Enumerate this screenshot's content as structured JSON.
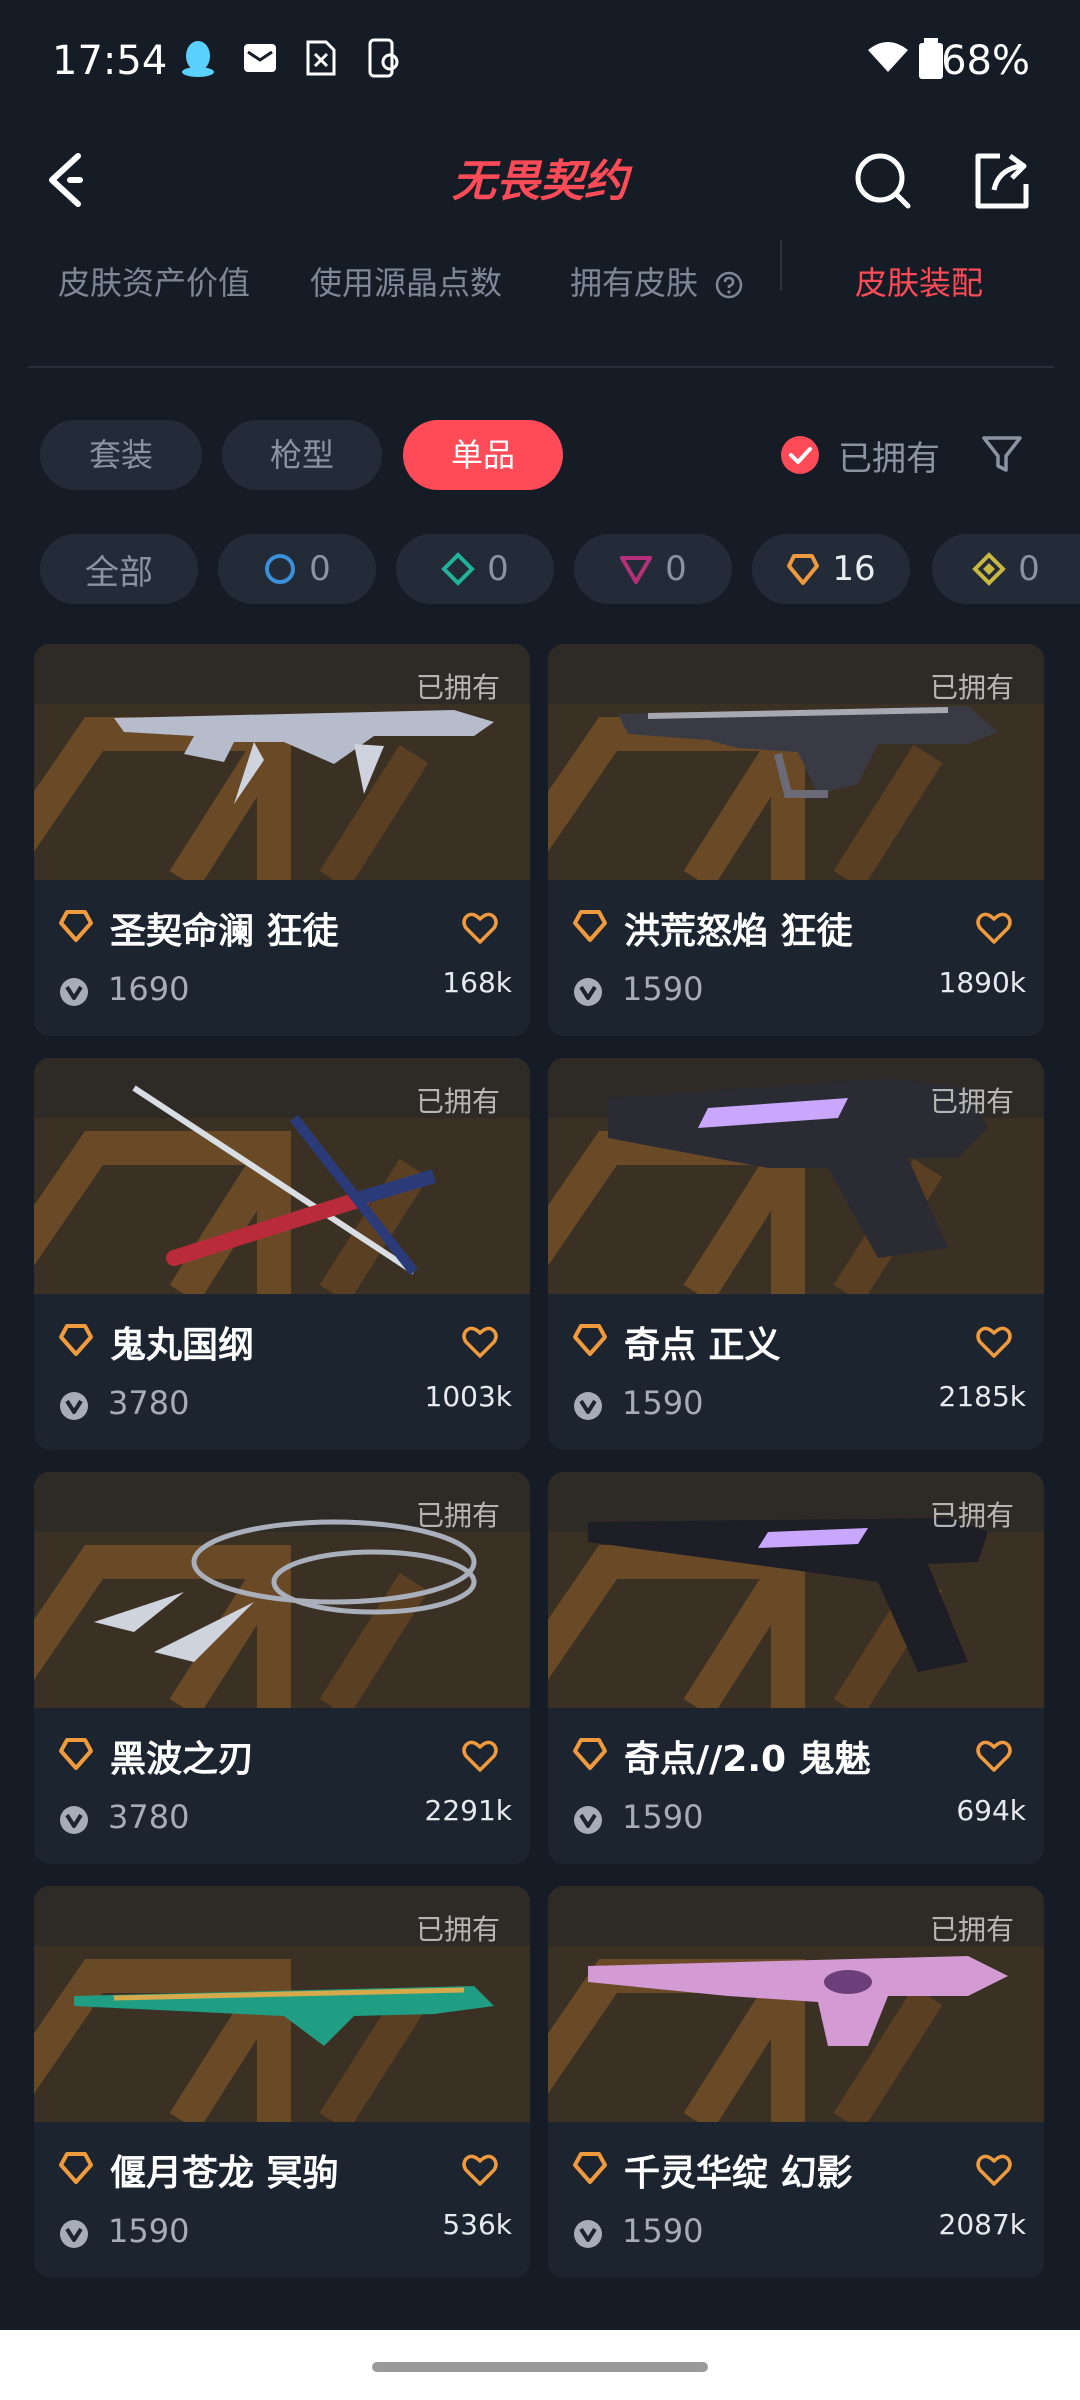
{
  "status_bar": {
    "time": "17:54",
    "battery": "68%"
  },
  "header": {
    "logo_text": "无畏契约"
  },
  "top_tabs": [
    {
      "label": "皮肤资产价值"
    },
    {
      "label": "使用源晶点数"
    },
    {
      "label": "拥有皮肤"
    },
    {
      "label": "皮肤装配"
    }
  ],
  "category_chips": [
    {
      "label": "套装"
    },
    {
      "label": "枪型"
    },
    {
      "label": "单品"
    }
  ],
  "owned_filter_label": "已拥有",
  "rarity_chips": [
    {
      "label": "全部"
    },
    {
      "count": "0",
      "color": "#3a8fd8"
    },
    {
      "count": "0",
      "color": "#1fb39a"
    },
    {
      "count": "0",
      "color": "#b5307a"
    },
    {
      "count": "16",
      "color": "#f09a3e"
    },
    {
      "count": "0",
      "color": "#c8b740"
    }
  ],
  "cards": [
    {
      "owned": "已拥有",
      "name": "圣契命澜 狂徒",
      "price": "1690",
      "likes": "168k"
    },
    {
      "owned": "已拥有",
      "name": "洪荒怒焰 狂徒",
      "price": "1590",
      "likes": "1890k"
    },
    {
      "owned": "已拥有",
      "name": "鬼丸国纲",
      "price": "3780",
      "likes": "1003k"
    },
    {
      "owned": "已拥有",
      "name": "奇点 正义",
      "price": "1590",
      "likes": "2185k"
    },
    {
      "owned": "已拥有",
      "name": "黑波之刃",
      "price": "3780",
      "likes": "2291k"
    },
    {
      "owned": "已拥有",
      "name": "奇点//2.0 鬼魅",
      "price": "1590",
      "likes": "694k"
    },
    {
      "owned": "已拥有",
      "name": "偃月苍龙 冥驹",
      "price": "1590",
      "likes": "536k"
    },
    {
      "owned": "已拥有",
      "name": "千灵华绽 幻影",
      "price": "1590",
      "likes": "2087k"
    }
  ],
  "colors": {
    "accent": "#ff4b57",
    "background": "#151c25",
    "card": "#1c2430",
    "tier": "#f09a3e"
  }
}
